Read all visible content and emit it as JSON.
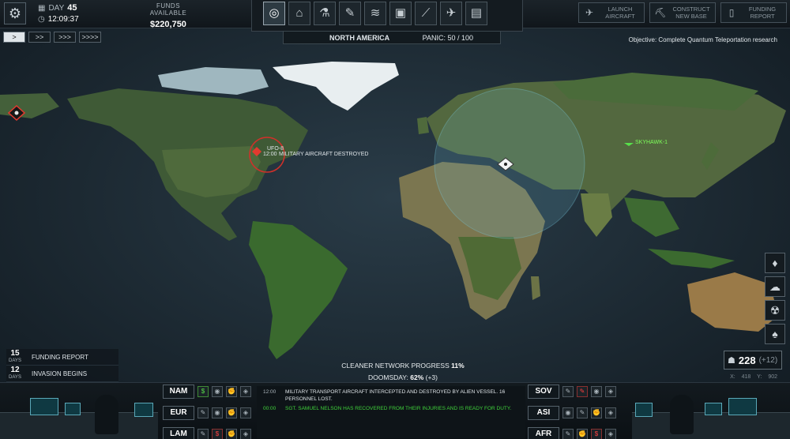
{
  "top": {
    "day_label": "DAY",
    "day_value": "45",
    "time": "12:09:37",
    "funds_label": "FUNDS AVAILABLE",
    "funds_value": "$220,750",
    "tabs": [
      "globe-icon",
      "hangar-icon",
      "research-icon",
      "engineering-icon",
      "barracks-icon",
      "base-icon",
      "weapons-icon",
      "aircraft-icon",
      "archive-icon"
    ],
    "actions": [
      {
        "label": "LAUNCH AIRCRAFT",
        "icon": "plane-icon"
      },
      {
        "label": "CONSTRUCT NEW BASE",
        "icon": "bulldozer-icon"
      },
      {
        "label": "FUNDING REPORT",
        "icon": "report-icon"
      }
    ]
  },
  "speed": [
    ">",
    ">>",
    ">>>",
    ">>>>"
  ],
  "region_bar": {
    "region": "NORTH AMERICA",
    "panic_label": "PANIC:",
    "panic_value": "50 / 100"
  },
  "objective": "Objective: Complete Quantum Teleportation research",
  "markers": {
    "ufo_name": "UFO-8",
    "ufo_time": "12:00",
    "ufo_status": "MILITARY AIRCRAFT DESTROYED",
    "aircraft_name": "SKYHAWK-1"
  },
  "events": [
    {
      "days": "15",
      "unit": "DAYS",
      "name": "FUNDING REPORT"
    },
    {
      "days": "12",
      "unit": "DAYS",
      "name": "INVASION BEGINS"
    }
  ],
  "progress": {
    "cleaner_label": "CLEANER NETWORK PROGRESS",
    "cleaner_value": "11%",
    "doomsday_label": "DOOMSDAY:",
    "doomsday_value": "62%",
    "doomsday_delta": "(+3)"
  },
  "scientists": {
    "value": "228",
    "delta": "(+12)"
  },
  "coords": {
    "x": "X: 418",
    "y": "Y: 902"
  },
  "regions_left": [
    {
      "name": "NAM",
      "icons": [
        "$",
        "eye",
        "fist",
        "shield"
      ]
    },
    {
      "name": "EUR",
      "icons": [
        "wrench",
        "eye",
        "fist",
        "shield"
      ]
    },
    {
      "name": "LAM",
      "icons": [
        "wrench",
        "$",
        "fist",
        "shield"
      ]
    }
  ],
  "regions_right": [
    {
      "name": "SOV",
      "icons": [
        "wrench",
        "wrench",
        "eye",
        "shield"
      ]
    },
    {
      "name": "ASI",
      "icons": [
        "eye",
        "wrench",
        "fist",
        "shield"
      ]
    },
    {
      "name": "AFR",
      "icons": [
        "wrench",
        "fist",
        "$",
        "shield"
      ]
    }
  ],
  "log": [
    {
      "time": "12:00",
      "text": "MILITARY TRANSPORT AIRCRAFT INTERCEPTED AND DESTROYED BY ALIEN VESSEL. 16 PERSONNEL LOST.",
      "color": "#e0e6ea"
    },
    {
      "time": "00:00",
      "text": "SGT. SAMUEL NELSON HAS RECOVERED FROM THEIR INJURIES AND IS READY FOR DUTY.",
      "color": "#3fd23a"
    }
  ]
}
